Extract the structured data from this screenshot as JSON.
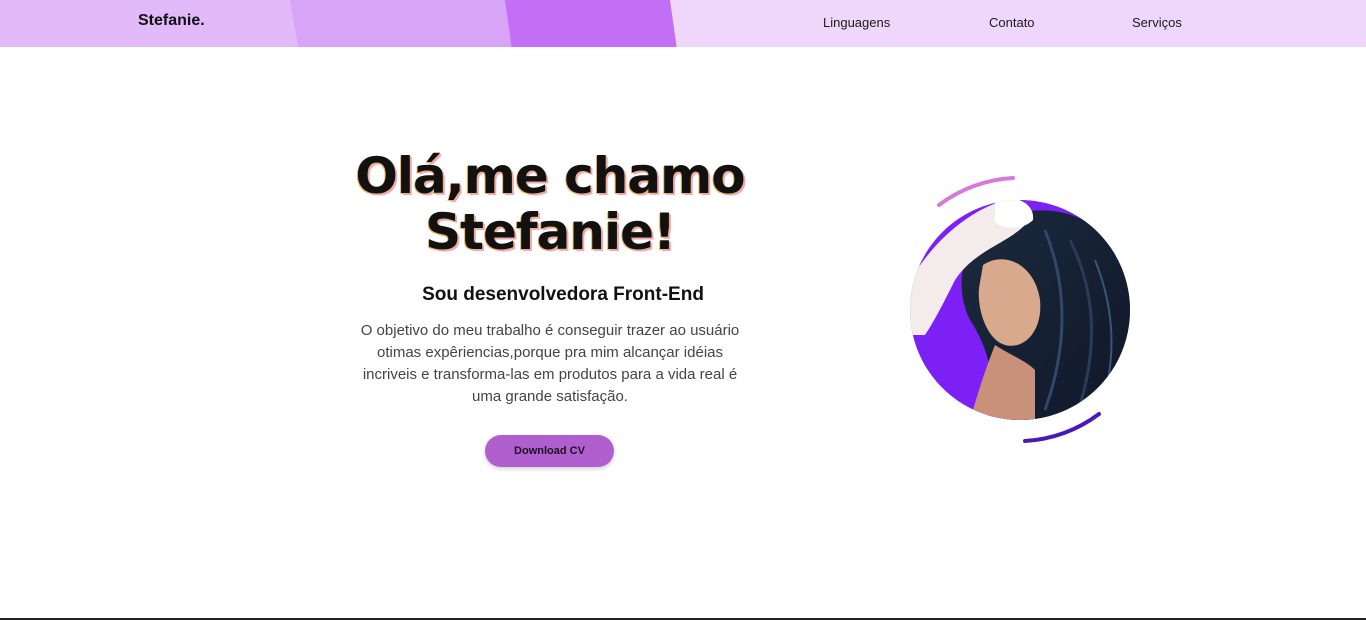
{
  "header": {
    "brand": "Stefanie.",
    "nav": [
      "Linguagens",
      "Contato",
      "Serviços"
    ]
  },
  "hero": {
    "title_line1": "Olá,me chamo",
    "title_line2": "Stefanie!",
    "subtitle": "Sou desenvolvedora Front-End",
    "description": "O objetivo do meu trabalho é conseguir trazer ao usuário otimas expêriencias,porque pra mim alcançar idéias incriveis e transforma-las em produtos para a vida real é uma grande satisfação.",
    "button_label": "Download CV"
  },
  "colors": {
    "nav_background": "#efd6fb",
    "accent_purple": "#c36ff5",
    "button_purple": "#b05fce",
    "ring_pink": "#d57ad8",
    "ring_dark_purple": "#4a1ab8",
    "photo_background": "#7d20f5"
  }
}
